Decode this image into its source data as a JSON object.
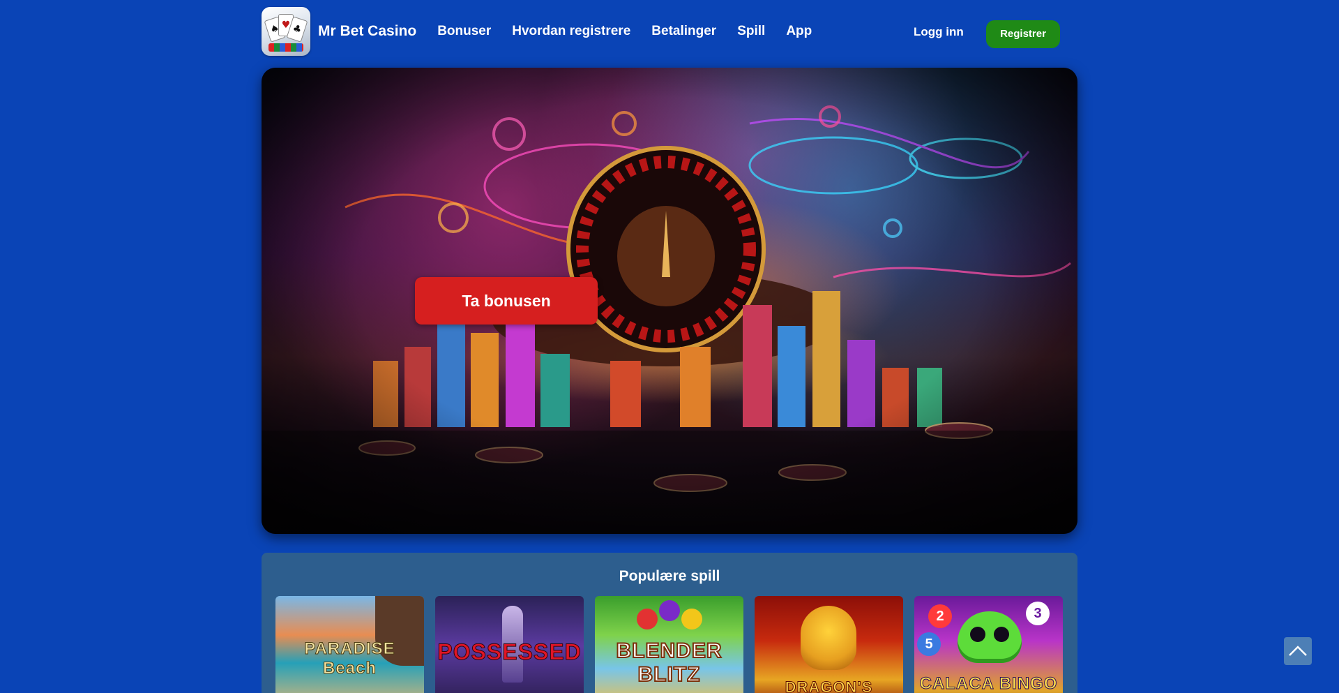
{
  "header": {
    "brand": "Mr Bet Casino",
    "nav": [
      "Bonuser",
      "Hvordan registrere",
      "Betalinger",
      "Spill",
      "App"
    ],
    "login_label": "Logg inn",
    "register_label": "Registrer"
  },
  "hero": {
    "cta_label": "Ta bonusen"
  },
  "popular_games": {
    "title": "Populære spill",
    "games": [
      {
        "name": "PARADISE Beach"
      },
      {
        "name": "POSSESSED"
      },
      {
        "name": "BLENDER BLITZ"
      },
      {
        "name": "DRAGON'S MONEY"
      },
      {
        "name": "CALACA BINGO"
      }
    ]
  },
  "colors": {
    "page_background": "#0a44b6",
    "register_button": "#1f8a16",
    "cta_button": "#d61f1f",
    "games_panel": "#2d5e8e"
  },
  "icons": {
    "scroll_top": "chevron-up-icon"
  }
}
